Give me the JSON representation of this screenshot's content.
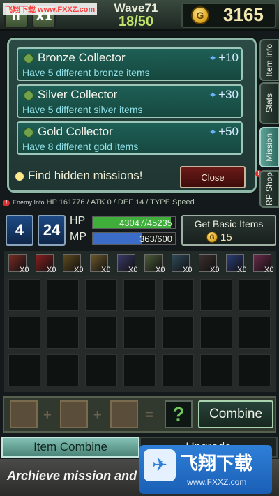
{
  "watermark": {
    "top_text": "飞翔下载 www.FXXZ.com",
    "logo_text": "飞翔下载",
    "logo_url": "www.FXXZ.com"
  },
  "top_bar": {
    "pause_label": "II",
    "speed_label": "X1",
    "wave_label": "Wave71",
    "wave_progress": "18/50",
    "coin_symbol": "G",
    "gold_amount": "3165"
  },
  "missions": [
    {
      "title": "Bronze Collector",
      "description": "Have 5 different bronze items",
      "reward": "+10"
    },
    {
      "title": "Silver Collector",
      "description": "Have 5 different silver items",
      "reward": "+30"
    },
    {
      "title": "Gold Collector",
      "description": "Have 8 different gold items",
      "reward": "+50"
    }
  ],
  "hidden_missions_text": "Find hidden missions!",
  "close_label": "Close",
  "side_tabs": [
    {
      "label": "Item Info"
    },
    {
      "label": "Stats"
    },
    {
      "label": "Mission",
      "active": true
    },
    {
      "label": "RP Shop"
    }
  ],
  "enemy_info": {
    "label": "Enemy Info",
    "stats": "HP 161776 / ATK 0 / DEF 14 / TYPE Speed"
  },
  "hero": {
    "badge1": "4",
    "badge2": "24",
    "hp_label": "HP",
    "hp_value": "43047/45235",
    "hp_fraction": 0.952,
    "mp_label": "MP",
    "mp_value": "363/600",
    "mp_fraction": 0.605
  },
  "basic_items": {
    "label": "Get Basic Items",
    "cost": "15"
  },
  "items": [
    {
      "count": "X0"
    },
    {
      "count": "X0"
    },
    {
      "count": "X0"
    },
    {
      "count": "X0"
    },
    {
      "count": "X0"
    },
    {
      "count": "X0"
    },
    {
      "count": "X0"
    },
    {
      "count": "X0"
    },
    {
      "count": "X0"
    },
    {
      "count": "X0"
    }
  ],
  "combine": {
    "plus": "+",
    "equals": "=",
    "result": "?",
    "button_label": "Combine"
  },
  "tabs": {
    "combine": "Item Combine",
    "upgrade": "Upgrade"
  },
  "caption": "Archieve mission and get RP!",
  "colors": {
    "hp": "#3fae3a",
    "mp": "#3a6cc8",
    "accent": "#8fb8a8",
    "gold": "#f3e8b0"
  }
}
